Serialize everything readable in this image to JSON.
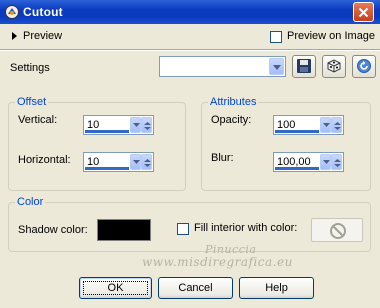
{
  "window": {
    "title": "Cutout",
    "close_icon": "close-icon",
    "app_icon": "app-icon"
  },
  "preview": {
    "label": "Preview",
    "preview_on_image_label": "Preview on Image",
    "preview_on_image_checked": false
  },
  "settings": {
    "label": "Settings",
    "selected_value": "",
    "icons": [
      "save-preset-icon",
      "randomize-dice-icon",
      "reset-icon"
    ]
  },
  "offset": {
    "legend": "Offset",
    "vertical_label": "Vertical:",
    "vertical_value": "10",
    "horizontal_label": "Horizontal:",
    "horizontal_value": "10"
  },
  "attributes": {
    "legend": "Attributes",
    "opacity_label": "Opacity:",
    "opacity_value": "100",
    "blur_label": "Blur:",
    "blur_value": "100,00"
  },
  "color": {
    "legend": "Color",
    "shadow_label": "Shadow color:",
    "shadow_color": "#000000",
    "fill_interior_label": "Fill interior with color:",
    "fill_interior_checked": false,
    "fill_icon": "no-color-icon"
  },
  "watermark": {
    "line1": "Pinuccia",
    "line2": "www.misdiregrafica.eu"
  },
  "buttons": {
    "ok": "OK",
    "cancel": "Cancel",
    "help": "Help"
  }
}
